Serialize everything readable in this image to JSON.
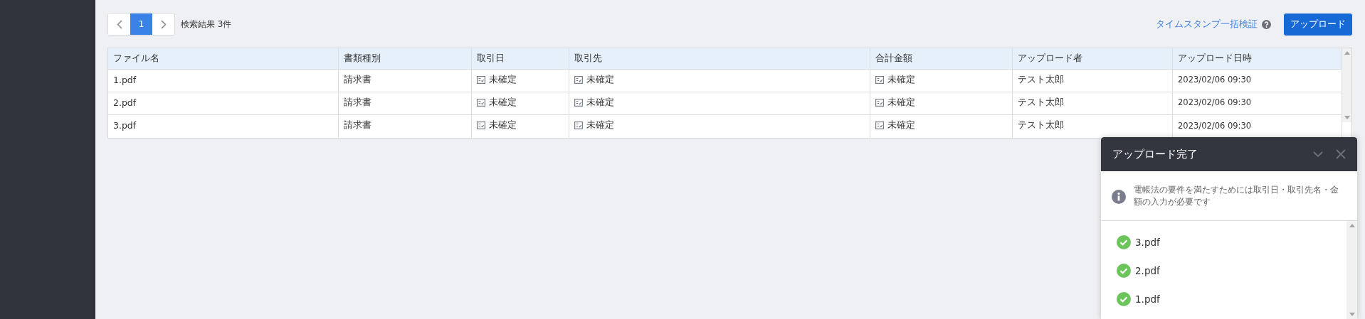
{
  "pagination": {
    "pages": [
      {
        "label": "1",
        "selected": true
      }
    ]
  },
  "result_count": "検索結果 3件",
  "timestamp_link": "タイムスタンプ一括検証",
  "upload_button": "アップロード",
  "table": {
    "columns": [
      {
        "label": "ファイル名",
        "kind": "text"
      },
      {
        "label": "書類種別",
        "kind": "text"
      },
      {
        "label": "取引日",
        "kind": "status"
      },
      {
        "label": "取引先",
        "kind": "status"
      },
      {
        "label": "合計金額",
        "kind": "status"
      },
      {
        "label": "アップロード者",
        "kind": "text"
      },
      {
        "label": "アップロード日時",
        "kind": "date"
      }
    ],
    "rows": [
      {
        "cells": [
          "1.pdf",
          "請求書",
          "未確定",
          "未確定",
          "未確定",
          "テスト太郎",
          "2023/02/06 09:30"
        ]
      },
      {
        "cells": [
          "2.pdf",
          "請求書",
          "未確定",
          "未確定",
          "未確定",
          "テスト太郎",
          "2023/02/06 09:30"
        ]
      },
      {
        "cells": [
          "3.pdf",
          "請求書",
          "未確定",
          "未確定",
          "未確定",
          "テスト太郎",
          "2023/02/06 09:30"
        ]
      }
    ]
  },
  "upload_panel": {
    "title": "アップロード完了",
    "notice": "電帳法の要件を満たすためには取引日・取引先名・金額の入力が必要です",
    "files": [
      {
        "name": "3.pdf",
        "uploaded": true
      },
      {
        "name": "2.pdf",
        "uploaded": true
      },
      {
        "name": "1.pdf",
        "uploaded": true
      }
    ]
  }
}
